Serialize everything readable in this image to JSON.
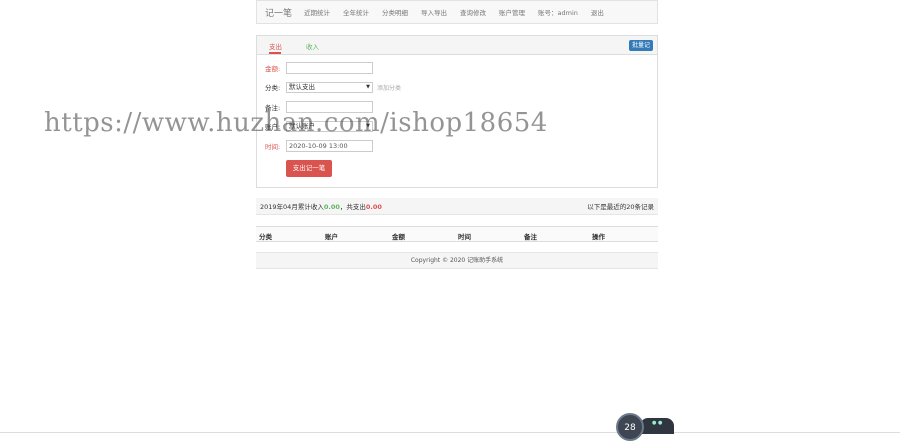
{
  "navbar": {
    "brand": "记一笔",
    "items": [
      "近期统计",
      "全年统计",
      "分类明细",
      "导入导出",
      "查询修改",
      "账户管理",
      "账号：admin",
      "退出"
    ]
  },
  "form": {
    "tabs": {
      "expense": "支出",
      "income": "收入"
    },
    "batch_button": "批量记",
    "amount_label": "金额:",
    "amount_value": "",
    "category_label": "分类:",
    "category_value": "默认支出",
    "add_category": "添加分类",
    "note_label": "备注:",
    "note_value": "",
    "account_label": "账户:",
    "account_value": "默认账户",
    "time_label": "时间:",
    "time_value": "2020-10-09 13:00",
    "submit": "支出记一笔"
  },
  "summary": {
    "prefix": "2019年04月累计收入",
    "income": "0.00",
    "mid": "，共支出",
    "expense": "0.00",
    "right": "以下是最近的20条记录"
  },
  "table": {
    "headers": [
      "分类",
      "账户",
      "金额",
      "时间",
      "备注",
      "操作"
    ]
  },
  "footer": {
    "text": "Copyright © 2020 记账助手系统"
  },
  "watermark": "https://www.huzhan.com/ishop18654",
  "widget": {
    "value": "28",
    "unit": "%"
  },
  "colors": {
    "expense": "#d9534f",
    "income": "#5cb85c",
    "primary": "#337ab7"
  }
}
